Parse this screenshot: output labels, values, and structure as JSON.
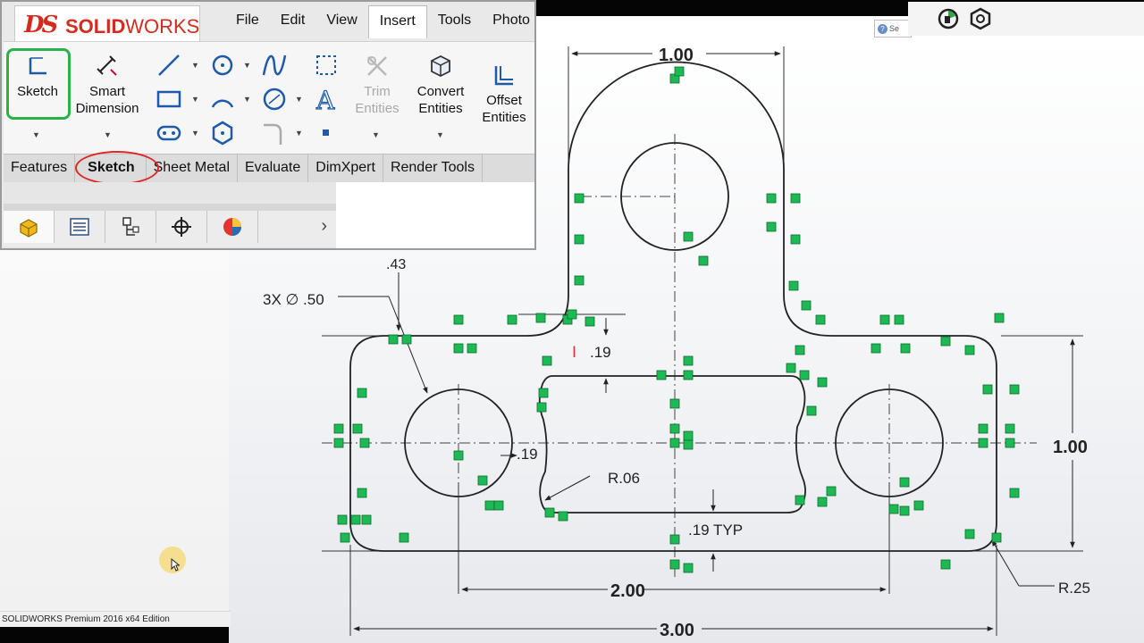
{
  "app": {
    "name": "SOLIDWORKS",
    "logo_prefix": "DS",
    "logo_solid": "SOLID",
    "logo_works": "WORKS"
  },
  "menu": [
    "File",
    "Edit",
    "View",
    "Insert",
    "Tools",
    "Photo"
  ],
  "active_menu": "Insert",
  "ribbon": {
    "sketch_label": "Sketch",
    "smart_dimension_label": [
      "Smart",
      "Dimension"
    ],
    "trim_entities_label": [
      "Trim",
      "Entities"
    ],
    "convert_entities_label": [
      "Convert",
      "Entities"
    ],
    "offset_entities_label": [
      "Offset",
      "Entities"
    ]
  },
  "tabs": [
    "Features",
    "Sketch",
    "Sheet Metal",
    "Evaluate",
    "DimXpert",
    "Render Tools"
  ],
  "active_tab": "Sketch",
  "search": {
    "placeholder": "Se"
  },
  "status_bar": {
    "text": "SOLIDWORKS Premium 2016 x64 Edition"
  },
  "drawing": {
    "dims": {
      "top_width": "1.00",
      "height_right": "1.00",
      "overall_width": "3.00",
      "hole_spacing": "2.00",
      "offset_43": ".43",
      "holes": "3X ∅ .50",
      "slot_depth": ".19",
      "slot_side": ".19",
      "fillet_small": "R.06",
      "typ": ".19 TYP",
      "fillet_large": "R.25"
    }
  },
  "colors": {
    "accent_red": "#d52b1e",
    "green_highlight": "#27b24a",
    "oval_red": "#e02424",
    "relation_green": "#1db954"
  },
  "icons": [
    "sketch-icon",
    "smart-dimension-icon",
    "line-icon",
    "circle-icon",
    "spline-icon",
    "construction-geometry-icon",
    "rectangle-icon",
    "arc-icon",
    "ellipse-icon",
    "text-icon",
    "slot-icon",
    "polygon-icon",
    "fillet-icon",
    "point-icon",
    "trim-entities-icon",
    "convert-entities-icon",
    "offset-entities-icon",
    "feature-manager-icon",
    "property-manager-icon",
    "configuration-manager-icon",
    "dimxpert-manager-icon",
    "display-manager-icon"
  ]
}
